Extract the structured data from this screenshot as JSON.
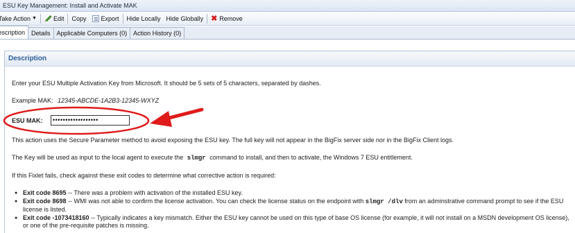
{
  "window": {
    "title": "ESU Key Management: Install and Activate MAK"
  },
  "toolbar": {
    "take_action": "Take Action",
    "edit": "Edit",
    "copy": "Copy",
    "export": "Export",
    "hide_locally": "Hide Locally",
    "hide_globally": "Hide Globally",
    "remove": "Remove"
  },
  "tabs": [
    {
      "label": "Description",
      "active": true
    },
    {
      "label": "Details",
      "active": false
    },
    {
      "label": "Applicable Computers (0)",
      "active": false
    },
    {
      "label": "Action History (0)",
      "active": false
    }
  ],
  "description": {
    "header": "Description",
    "intro": "Enter your ESU Multiple Activation Key from Microsoft. It should be 5 sets of 5 characters, separated by dashes.",
    "example_label": "Example MAK:",
    "example_value": "12345-ABCDE-1A2B3-12345-WXYZ",
    "esu_label": "ESU MAK:",
    "esu_value": "••••••••••••••••••",
    "secure_param": "This action uses the Secure Parameter method to avoid exposing the ESU key. The full key will not appear in the BigFix server side nor in the BigFix Client logs.",
    "key_use_pre": "The Key will be used as input to the local agent to execute the",
    "key_use_cmd": "slmgr",
    "key_use_post": "command to install, and then to activate, the Windows 7 ESU entitlement.",
    "fail_text": "If this Fixlet fails, check against these exit codes to determine what corrective action is required:",
    "exit_codes": [
      {
        "code": "Exit code 8695",
        "text": " -- There was a problem with activation of the installed ESU key."
      },
      {
        "code": "Exit code 8698",
        "text_pre": " -- WMI was not able to confirm the license activation. You can check the license status on the endpoint with ",
        "cmd": "slmgr /dlv",
        "text_post": " from an adminstrative command prompt to see if the ESU license is listed."
      },
      {
        "code": "Exit code -1073418160",
        "text": " -- Typically indicates a key mismatch.  Either the ESU key cannot be used on this type of base OS license (for example, it will not install on a MSDN development OS license), or one of the pre-requisite patches is missing."
      }
    ]
  },
  "colors": {
    "annotation": "#e01b1b",
    "header_text": "#2a5b96",
    "remove_icon": "#d11f1f"
  },
  "icons": {
    "edit": "pencil-icon",
    "export": "export-icon",
    "remove": "remove-icon"
  }
}
